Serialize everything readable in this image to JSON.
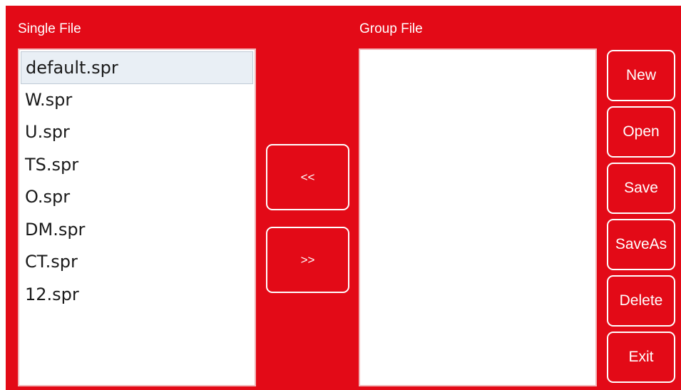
{
  "single_file": {
    "title": "Single File",
    "files": [
      "default.spr",
      "W.spr",
      "U.spr",
      "TS.spr",
      "O.spr",
      "DM.spr",
      "CT.spr",
      "12.spr"
    ],
    "selected_index": 0
  },
  "group_file": {
    "title": "Group File",
    "files": []
  },
  "transfer": {
    "move_left_label": "<<",
    "move_right_label": ">>"
  },
  "actions": {
    "new_label": "New",
    "open_label": "Open",
    "save_label": "Save",
    "save_as_label": "SaveAs",
    "delete_label": "Delete",
    "exit_label": "Exit"
  },
  "colors": {
    "background": "#e30a17",
    "foreground": "#ffffff",
    "selection": "#e9eff5"
  }
}
